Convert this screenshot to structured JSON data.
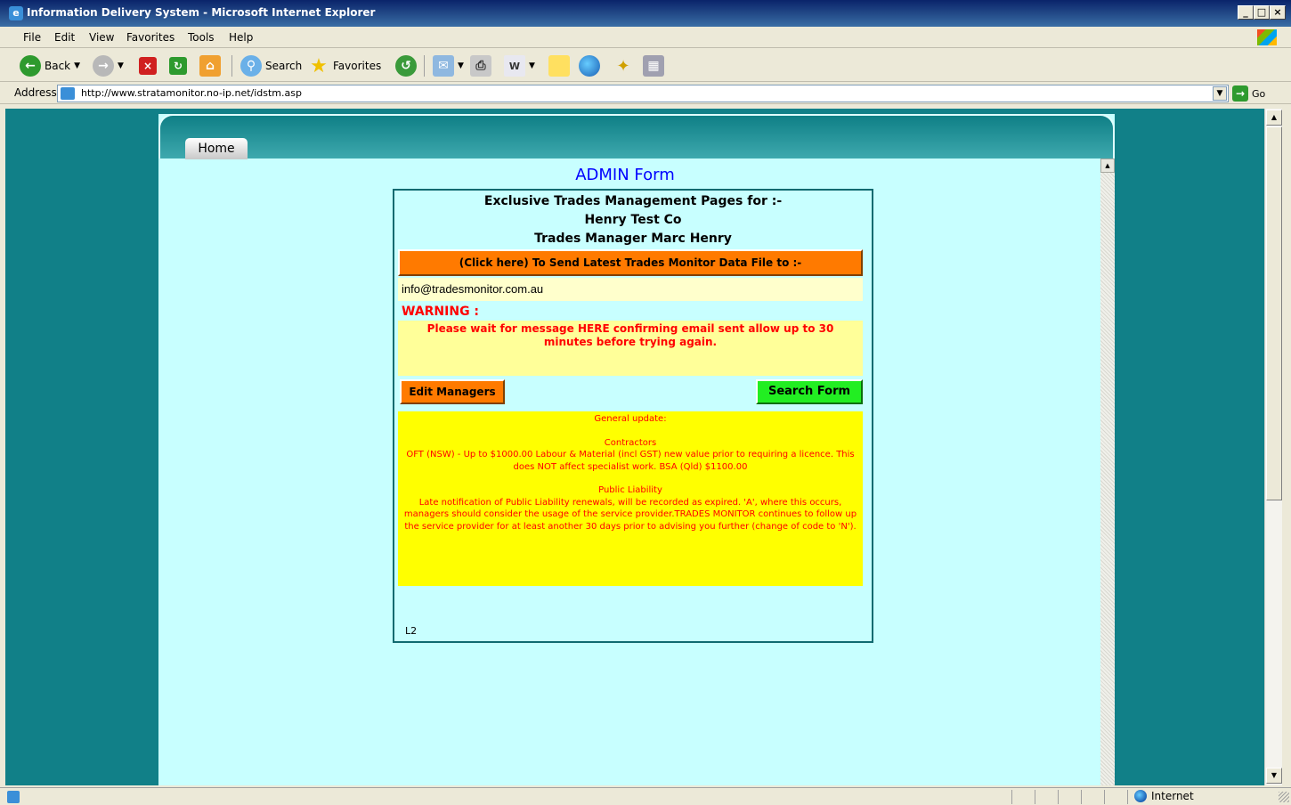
{
  "window": {
    "title": "Information Delivery System - Microsoft Internet Explorer",
    "controls": [
      "_",
      "□",
      "×"
    ]
  },
  "menu": [
    "File",
    "Edit",
    "View",
    "Favorites",
    "Tools",
    "Help"
  ],
  "toolbar": {
    "back": "Back",
    "search": "Search",
    "favorites": "Favorites"
  },
  "address": {
    "label": "Address",
    "url": "http://www.stratamonitor.no-ip.net/idstm.asp",
    "go": "Go"
  },
  "page": {
    "home_tab": "Home",
    "form_title": "ADMIN Form",
    "heading_line1": "Exclusive Trades Management Pages for :-",
    "heading_line2": "Henry Test Co",
    "heading_line3": "Trades Manager Marc Henry",
    "send_button": "(Click here) To Send Latest Trades Monitor  Data File  to :-",
    "email": "info@tradesmonitor.com.au",
    "warning_label": "WARNING :",
    "warning_message": "Please wait for message HERE confirming email sent allow up to 30 minutes before trying again.",
    "edit_managers": "Edit Managers",
    "search_form": "Search  Form",
    "update": {
      "heading": "General update:",
      "contractors_heading": "Contractors",
      "contractors_text": "OFT (NSW) - Up to $1000.00 Labour & Material (incl GST) new value prior to requiring a licence. This does NOT affect specialist work. BSA (Qld) $1100.00",
      "liability_heading": "Public Liability",
      "liability_text": "Late notification of Public Liability renewals, will be recorded as expired. 'A', where this occurs, managers should consider the usage of the service provider.TRADES MONITOR continues to follow up the service provider for at least another 30 days prior to advising you further (change of code to 'N')."
    },
    "page_code": "L2"
  },
  "status": {
    "zone": "Internet"
  },
  "colors": {
    "page_bg": "#118088",
    "content_bg": "#c8ffff",
    "orange_button": "#ff7a00",
    "green_button": "#22ee22",
    "warning_red": "#ff0000",
    "update_bg": "#ffff00",
    "title_blue": "#0000ff"
  }
}
